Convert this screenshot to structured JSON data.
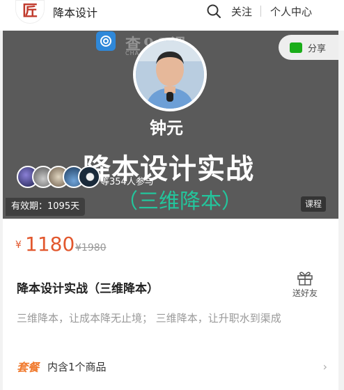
{
  "header": {
    "site_name": "降本设计",
    "follow_label": "关注",
    "profile_label": "个人中心"
  },
  "banner": {
    "watermark_text": "查98课",
    "watermark_sub": "CHA.98KE.COM",
    "share_label": "分享",
    "speaker": "钟元",
    "course_title": "降本设计实战",
    "course_subtitle": "（三维降本）",
    "participants_text": "等354人参与",
    "validity": "有效期：1095天",
    "type_tag": "课程"
  },
  "product": {
    "currency": "¥",
    "price": "1180",
    "original_price": "¥1980",
    "title": "降本设计实战（三维降本）",
    "gift_label": "送好友",
    "description": "三维降本，让成本降无止境；   三维降本，让升职水到渠成",
    "package_badge": "套餐",
    "package_text": "内含1个商品"
  },
  "colors": {
    "accent": "#e2572d",
    "subtitle_green": "#23c59c",
    "package_orange": "#f07a2e"
  },
  "icons": [
    "search-icon",
    "wechat-icon",
    "gift-icon",
    "chevron-right-icon"
  ]
}
